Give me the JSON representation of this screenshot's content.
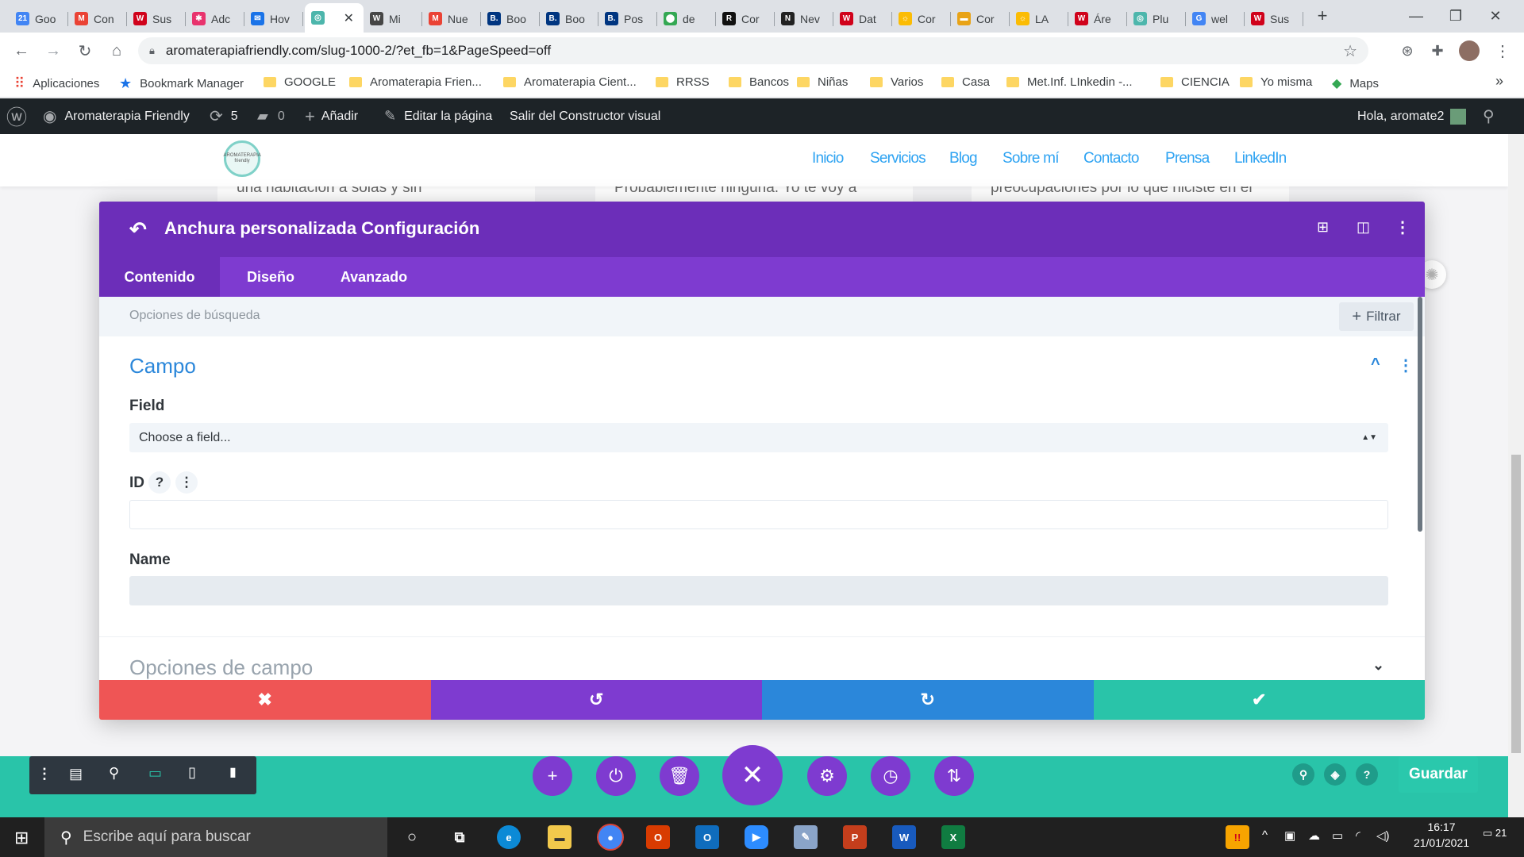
{
  "browser": {
    "tabs": [
      {
        "label": "Goo",
        "icon": "calendar-icon",
        "color": "#4285f4",
        "glyph": "21"
      },
      {
        "label": "Con",
        "icon": "gmail-icon",
        "color": "#ea4335",
        "glyph": "M"
      },
      {
        "label": "Sus",
        "icon": "w-icon",
        "color": "#d0021b",
        "glyph": "W"
      },
      {
        "label": "Adc",
        "icon": "asterisk-icon",
        "color": "#e8336d",
        "glyph": "✱"
      },
      {
        "label": "Hov",
        "icon": "mail-icon",
        "color": "#1a73e8",
        "glyph": "✉"
      },
      {
        "label": "",
        "icon": "aromaterapia-icon",
        "color": "#4db6ac",
        "glyph": "◎"
      },
      {
        "label": "Mi",
        "icon": "wordpress-icon",
        "color": "#464646",
        "glyph": "W"
      },
      {
        "label": "Nue",
        "icon": "gmail-icon",
        "color": "#ea4335",
        "glyph": "M"
      },
      {
        "label": "Boo",
        "icon": "booking-icon",
        "color": "#003580",
        "glyph": "B."
      },
      {
        "label": "Boo",
        "icon": "booking-icon",
        "color": "#003580",
        "glyph": "B."
      },
      {
        "label": "Pos",
        "icon": "booking-icon",
        "color": "#003580",
        "glyph": "B."
      },
      {
        "label": "de",
        "icon": "maps-pin-icon",
        "color": "#34a853",
        "glyph": "⬤"
      },
      {
        "label": "Cor",
        "icon": "r-icon",
        "color": "#111111",
        "glyph": "R"
      },
      {
        "label": "Nev",
        "icon": "n-icon",
        "color": "#222222",
        "glyph": "N"
      },
      {
        "label": "Dat",
        "icon": "w-icon",
        "color": "#d0021b",
        "glyph": "W"
      },
      {
        "label": "Cor",
        "icon": "sun-icon",
        "color": "#fbbc04",
        "glyph": "☼"
      },
      {
        "label": "Cor",
        "icon": "folder-icon",
        "color": "#e8a317",
        "glyph": "▬"
      },
      {
        "label": "LA",
        "icon": "sun-icon",
        "color": "#fbbc04",
        "glyph": "☼"
      },
      {
        "label": "Áre",
        "icon": "w-icon",
        "color": "#d0021b",
        "glyph": "W"
      },
      {
        "label": "Plu",
        "icon": "aromaterapia-icon",
        "color": "#4db6ac",
        "glyph": "◎"
      },
      {
        "label": "wel",
        "icon": "google-icon",
        "color": "#4285f4",
        "glyph": "G"
      },
      {
        "label": "Sus",
        "icon": "w-icon",
        "color": "#d0021b",
        "glyph": "W"
      }
    ],
    "new_tab": "+",
    "url": "aromaterapiafriendly.com/slug-1000-2/?et_fb=1&PageSpeed=off",
    "bookmarks": [
      {
        "label": "Aplicaciones",
        "type": "apps"
      },
      {
        "label": "Bookmark Manager",
        "type": "star"
      },
      {
        "label": "GOOGLE",
        "type": "folder"
      },
      {
        "label": "Aromaterapia Frien...",
        "type": "folder"
      },
      {
        "label": "Aromaterapia Cient...",
        "type": "folder"
      },
      {
        "label": "RRSS",
        "type": "folder"
      },
      {
        "label": "Bancos",
        "type": "folder"
      },
      {
        "label": "Niñas",
        "type": "folder"
      },
      {
        "label": "Varios",
        "type": "folder"
      },
      {
        "label": "Casa",
        "type": "folder"
      },
      {
        "label": "Met.Inf. LInkedin -...",
        "type": "folder"
      },
      {
        "label": "CIENCIA",
        "type": "folder"
      },
      {
        "label": "Yo misma",
        "type": "folder"
      },
      {
        "label": "Maps",
        "type": "maps"
      }
    ],
    "more": "»"
  },
  "adminbar": {
    "site_name": "Aromaterapia Friendly",
    "updates": "5",
    "comments": "0",
    "add_new": "Añadir",
    "edit_page": "Editar la página",
    "exit_builder": "Salir del Constructor visual",
    "greeting": "Hola, aromate2"
  },
  "site": {
    "logo_text": "AROMATERAPIA friendly",
    "nav": [
      "Inicio",
      "Servicios",
      "Blog",
      "Sobre mí",
      "Contacto",
      "Prensa",
      "LinkedIn"
    ],
    "cards": [
      "una habitación a solas y sin",
      "Probablemente ninguna. Yo te voy a",
      "preocupaciones por lo que hiciste en el"
    ]
  },
  "modal": {
    "title": "Anchura personalizada Configuración",
    "tabs": [
      "Contenido",
      "Diseño",
      "Avanzado"
    ],
    "search_placeholder": "Opciones de búsqueda",
    "filter_label": "Filtrar",
    "section_campo": "Campo",
    "field_label": "Field",
    "field_select_value": "Choose a field...",
    "id_label": "ID",
    "id_help": "?",
    "id_value": "",
    "name_label": "Name",
    "name_value": "",
    "section_opciones": "Opciones de campo",
    "footer_colors": [
      "#ef5555",
      "#7e3bd0",
      "#2b87da",
      "#29c4a9"
    ]
  },
  "builder": {
    "save_label": "Guardar"
  },
  "taskbar": {
    "search_placeholder": "Escribe aquí para buscar",
    "time": "16:17",
    "date": "21/01/2021",
    "notifications": "21"
  }
}
